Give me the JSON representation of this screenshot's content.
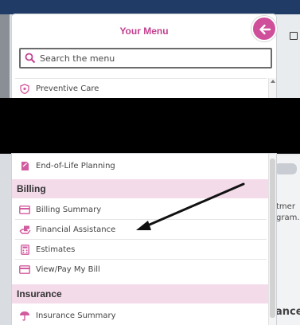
{
  "menu": {
    "title": "Your Menu",
    "search_placeholder": "Search the menu",
    "top_items": [
      {
        "label": "Preventive Care",
        "icon": "shield-icon"
      }
    ],
    "first_bottom_item": {
      "label": "End-of-Life Planning",
      "icon": "document-icon"
    },
    "sections": [
      {
        "title": "Billing",
        "items": [
          {
            "label": "Billing Summary",
            "icon": "card-icon"
          },
          {
            "label": "Financial Assistance",
            "icon": "money-hand-icon"
          },
          {
            "label": "Estimates",
            "icon": "calculator-icon"
          },
          {
            "label": "View/Pay My Bill",
            "icon": "card-icon"
          }
        ]
      },
      {
        "title": "Insurance",
        "items": [
          {
            "label": "Insurance Summary",
            "icon": "umbrella-icon"
          }
        ]
      }
    ]
  },
  "background_page": {
    "fragment_1": "tmer",
    "fragment_2": "gram.",
    "fragment_3": "ance"
  },
  "colors": {
    "accent": "#c2408f",
    "section_bg": "#f4dbea",
    "nav_bar": "#1f3b66"
  }
}
